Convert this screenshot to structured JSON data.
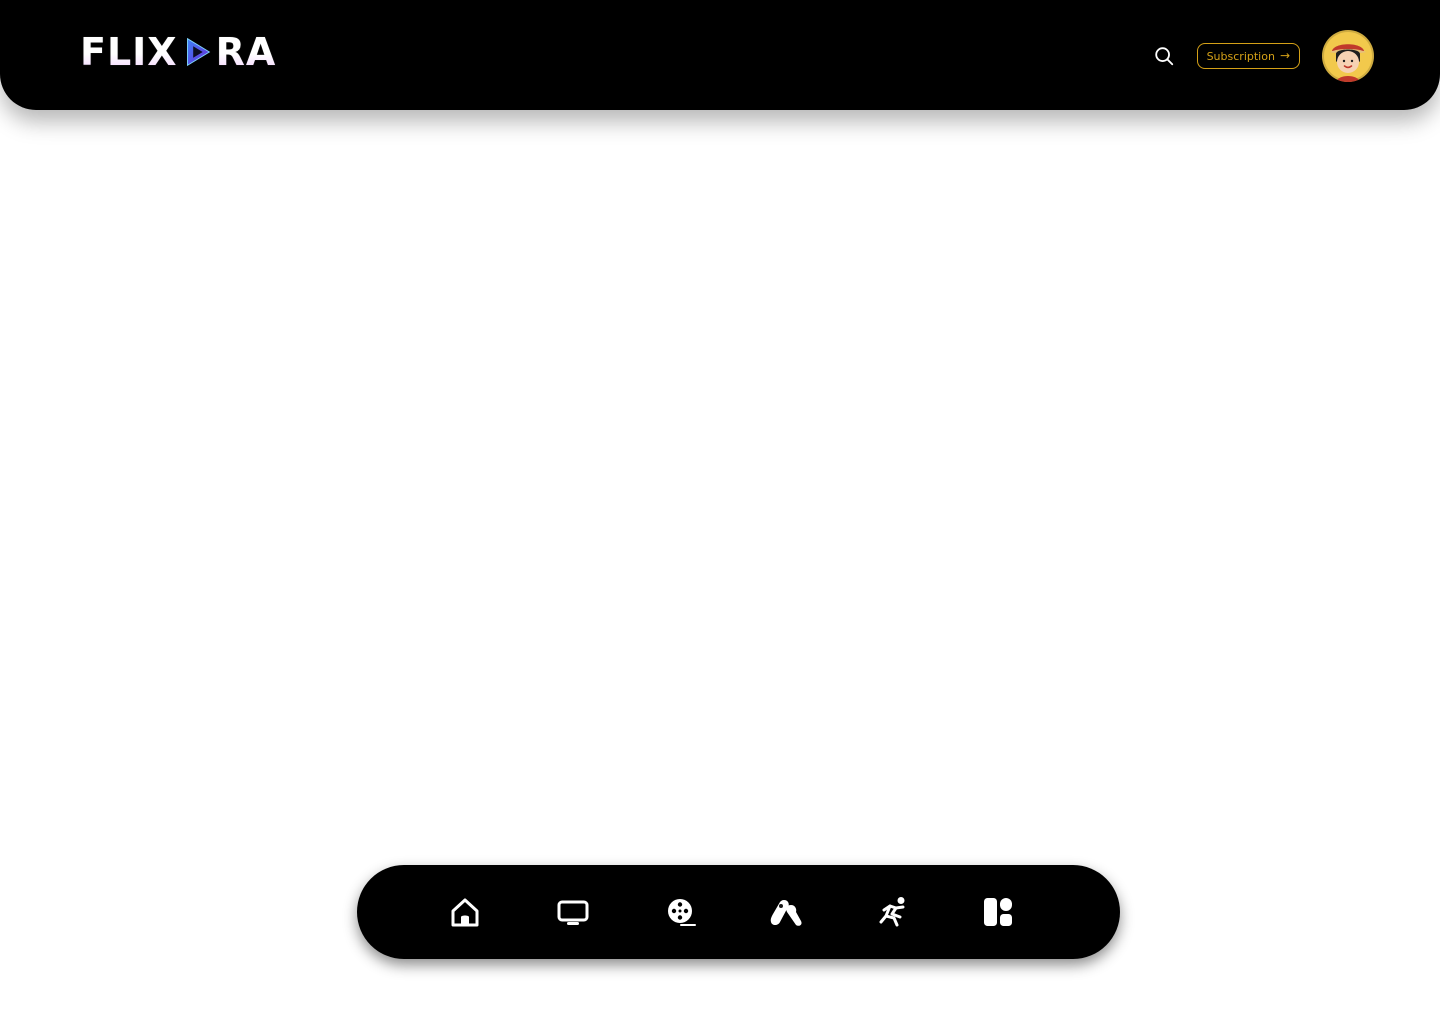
{
  "brand": {
    "logo_left": "FLIX",
    "logo_right": "RA"
  },
  "header": {
    "subscription_label": "Subscription",
    "subscription_arrow": "→"
  },
  "bottom_nav": [
    {
      "icon": "home-icon"
    },
    {
      "icon": "tv-icon"
    },
    {
      "icon": "movie-reel-icon"
    },
    {
      "icon": "anime-icon"
    },
    {
      "icon": "sports-icon"
    },
    {
      "icon": "categories-icon"
    }
  ],
  "colors": {
    "topbar_bg": "#000000",
    "bottom_nav_bg": "#000000",
    "accent_gold": "#d4a017",
    "avatar_bg": "#f2c94c"
  }
}
